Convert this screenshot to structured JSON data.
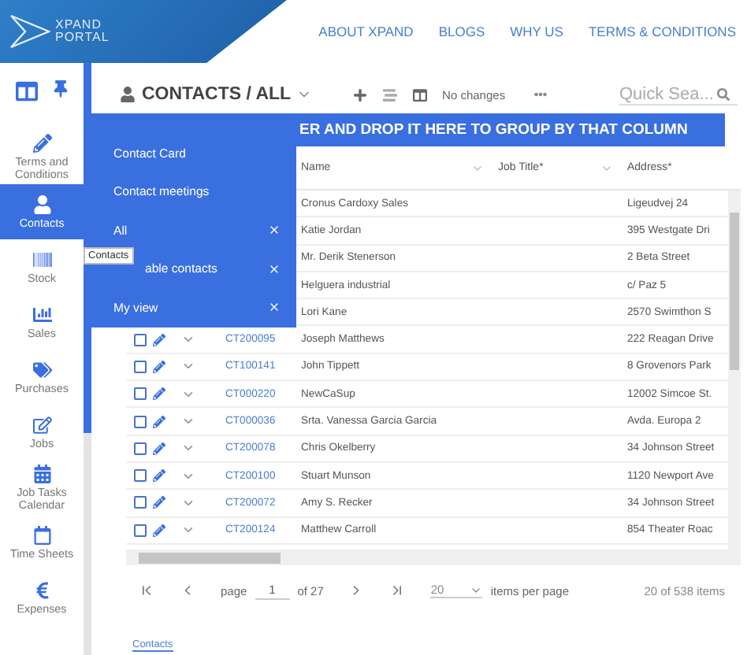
{
  "header": {
    "logo_lines": [
      "XPAND",
      "PORTAL"
    ],
    "nav": [
      "ABOUT XPAND",
      "BLOGS",
      "WHY US",
      "TERMS & CONDITIONS"
    ]
  },
  "sidebar": {
    "items": [
      {
        "kind": "terms",
        "label": "Terms and Conditions",
        "selected": false
      },
      {
        "kind": "contacts",
        "label": "Contacts",
        "selected": true
      },
      {
        "kind": "stock",
        "label": "Stock",
        "selected": false
      },
      {
        "kind": "sales",
        "label": "Sales",
        "selected": false
      },
      {
        "kind": "purchases",
        "label": "Purchases",
        "selected": false
      },
      {
        "kind": "jobs",
        "label": "Jobs",
        "selected": false
      },
      {
        "kind": "calendar",
        "label": "Job Tasks Calendar",
        "selected": false
      },
      {
        "kind": "timesheets",
        "label": "Time Sheets",
        "selected": false
      },
      {
        "kind": "expenses",
        "label": "Expenses",
        "selected": false
      }
    ]
  },
  "tooltip": "Contacts",
  "toolbar": {
    "title": "CONTACTS / ALL",
    "status": "No changes",
    "search": {
      "placeholder": "Quick Sea..."
    }
  },
  "view_menu": {
    "items": [
      {
        "label": "Contact Card",
        "removable": false
      },
      {
        "label": "Contact meetings",
        "removable": false
      },
      {
        "label": "All",
        "removable": true
      },
      {
        "label": "able contacts",
        "removable": true
      },
      {
        "label": "My view",
        "removable": true
      }
    ]
  },
  "group_banner": "ER AND DROP IT HERE TO GROUP BY THAT COLUMN",
  "table": {
    "columns": [
      "Name",
      "Job Title*",
      "Address*"
    ],
    "rows": [
      {
        "name": "Cronus Cardoxy Sales",
        "address": "Ligeudvej 24"
      },
      {
        "name": "Katie Jordan",
        "address": "395 Westgate Dri"
      },
      {
        "name": "Mr. Derik Stenerson",
        "address": "2 Beta Street"
      },
      {
        "name": "Helguera industrial",
        "address": "c/ Paz 5"
      },
      {
        "name": "Lori Kane",
        "address": "2570 Swimthon S"
      },
      {
        "code": "CT200095",
        "checked": false,
        "name": "Joseph Matthews",
        "address": "222 Reagan Drive"
      },
      {
        "code": "CT100141",
        "checked": false,
        "name": "John Tippett",
        "address": "8 Grovenors Park"
      },
      {
        "code": "CT000220",
        "checked": false,
        "name": "NewCaSup",
        "address": "12002 Simcoe St."
      },
      {
        "code": "CT000036",
        "checked": false,
        "name": "Srta. Vanessa Garcia Garcia",
        "address": "Avda. Europa 2"
      },
      {
        "code": "CT200078",
        "checked": false,
        "name": "Chris Okelberry",
        "address": "34 Johnson Street"
      },
      {
        "code": "CT200100",
        "checked": false,
        "name": "Stuart Munson",
        "address": "1120 Newport Ave"
      },
      {
        "code": "CT200072",
        "checked": false,
        "name": "Amy S. Recker",
        "address": "34 Johnson Street"
      },
      {
        "code": "CT200124",
        "checked": false,
        "name": "Matthew Carroll",
        "address": "854 Theater Roac"
      }
    ]
  },
  "pager": {
    "page_label": "page",
    "page": "1",
    "of": "of 27",
    "page_size": "20",
    "per_page_label": "items per page",
    "summary": "20 of 538 items"
  },
  "footer_link": "Contacts"
}
